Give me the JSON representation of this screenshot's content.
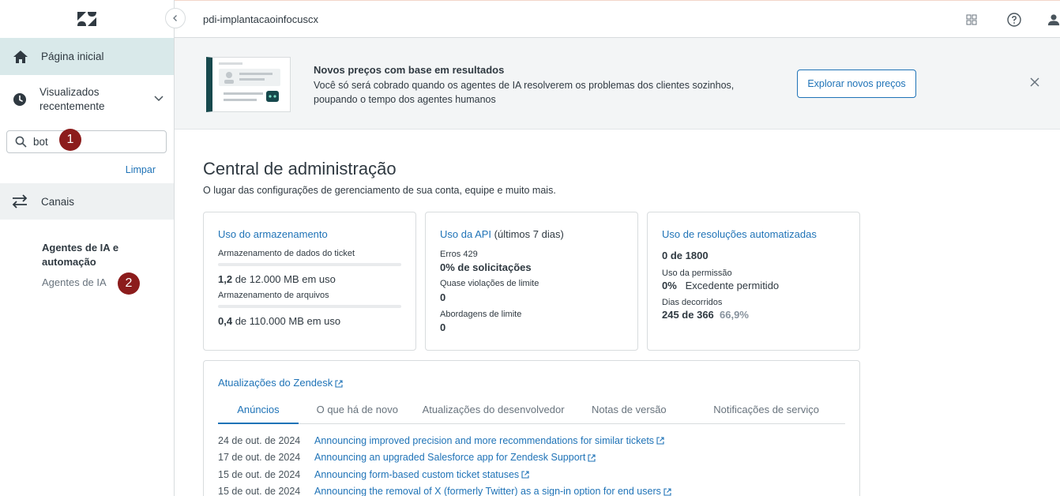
{
  "sidebar": {
    "home_label": "Página inicial",
    "recent_label": "Visualizados recentemente",
    "search_value": "bot",
    "clear_label": "Limpar",
    "channels_label": "Canais",
    "section_heading": "Agentes de IA e automação",
    "section_item": "Agentes de IA",
    "markers": [
      "1",
      "2"
    ]
  },
  "topbar": {
    "account_name": "pdi-implantacaoinfocuscx",
    "icons": [
      "grid-icon",
      "help-icon",
      "user-icon"
    ]
  },
  "banner": {
    "title": "Novos preços com base em resultados",
    "text": "Você só será cobrado quando os agentes de IA resolverem os problemas dos clientes sozinhos, poupando o tempo dos agentes humanos",
    "button_label": "Explorar novos preços"
  },
  "main": {
    "title": "Central de administração",
    "subtitle": "O lugar das configurações de gerenciamento de sua conta, equipe e muito mais."
  },
  "cards": {
    "storage": {
      "title": "Uso do armazenamento",
      "ticket_label": "Armazenamento de dados do ticket",
      "ticket_used": "1,2",
      "ticket_rest": " de 12.000 MB em uso",
      "files_label": "Armazenamento de arquivos",
      "files_used": "0,4",
      "files_rest": " de 110.000 MB em uso"
    },
    "api": {
      "title": "Uso da API",
      "title_suffix": " (últimos 7 dias)",
      "errors_label": "Erros 429",
      "errors_value": "0% de solicitações",
      "near_label": "Quase violações de limite",
      "near_value": "0",
      "limit_label": "Abordagens de limite",
      "limit_value": "0"
    },
    "resolutions": {
      "title": "Uso de resoluções automatizadas",
      "count": "0 de 1800",
      "permission_label": "Uso da permissão",
      "permission_pct": "0%",
      "permission_text": "Excedente permitido",
      "days_label": "Dias decorridos",
      "days_value": "245 de 366",
      "days_pct": "66,9%"
    }
  },
  "updates": {
    "title": "Atualizações do Zendesk",
    "tabs": [
      "Anúncios",
      "O que há de novo",
      "Atualizações do desenvolvedor",
      "Notas de versão",
      "Notificações de serviço"
    ],
    "rows": [
      {
        "date": "24 de out. de 2024",
        "text": "Announcing improved precision and more recommendations for similar tickets"
      },
      {
        "date": "17 de out. de 2024",
        "text": "Announcing an upgraded Salesforce app for Zendesk Support"
      },
      {
        "date": "15 de out. de 2024",
        "text": "Announcing form-based custom ticket statuses"
      },
      {
        "date": "15 de out. de 2024",
        "text": "Announcing the removal of X (formerly Twitter) as a sign-in option for end users"
      }
    ]
  }
}
